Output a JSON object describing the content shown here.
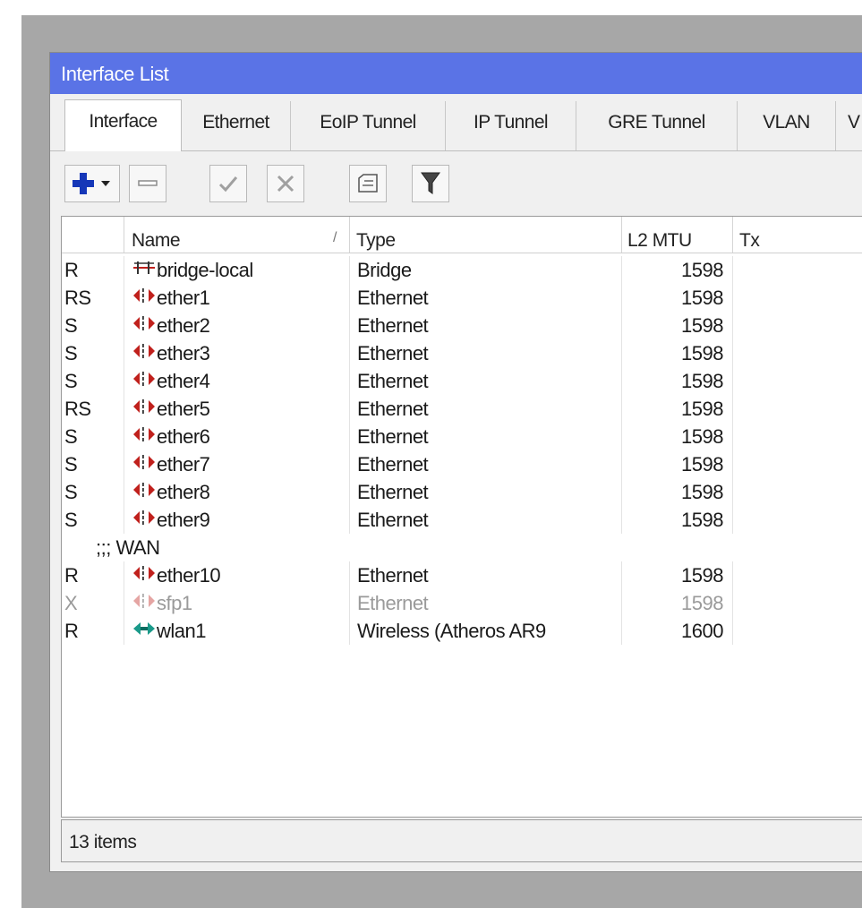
{
  "window": {
    "title": "Interface List"
  },
  "tabs": [
    {
      "label": "Interface",
      "active": true
    },
    {
      "label": "Ethernet",
      "active": false
    },
    {
      "label": "EoIP Tunnel",
      "active": false
    },
    {
      "label": "IP Tunnel",
      "active": false
    },
    {
      "label": "GRE Tunnel",
      "active": false
    },
    {
      "label": "VLAN",
      "active": false
    },
    {
      "label": "V",
      "active": false
    }
  ],
  "toolbar": {
    "buttons": [
      {
        "name": "add-dropdown-button",
        "icon": "plus-icon"
      },
      {
        "name": "remove-button",
        "icon": "minus-icon"
      },
      {
        "name": "enable-button",
        "icon": "check-icon"
      },
      {
        "name": "disable-button",
        "icon": "cross-icon"
      },
      {
        "name": "comment-button",
        "icon": "note-icon"
      },
      {
        "name": "filter-button",
        "icon": "funnel-icon"
      }
    ]
  },
  "table": {
    "columns": [
      "",
      "Name",
      "Type",
      "L2 MTU",
      "Tx"
    ],
    "sort_indicator": "/",
    "rows": [
      {
        "flags": "R",
        "name": "bridge-local",
        "icon": "bridge-icon",
        "type": "Bridge",
        "l2mtu": "1598"
      },
      {
        "flags": "RS",
        "name": "ether1",
        "icon": "ethernet-icon",
        "type": "Ethernet",
        "l2mtu": "1598"
      },
      {
        "flags": "S",
        "name": "ether2",
        "icon": "ethernet-icon",
        "type": "Ethernet",
        "l2mtu": "1598"
      },
      {
        "flags": "S",
        "name": "ether3",
        "icon": "ethernet-icon",
        "type": "Ethernet",
        "l2mtu": "1598"
      },
      {
        "flags": "S",
        "name": "ether4",
        "icon": "ethernet-icon",
        "type": "Ethernet",
        "l2mtu": "1598"
      },
      {
        "flags": "RS",
        "name": "ether5",
        "icon": "ethernet-icon",
        "type": "Ethernet",
        "l2mtu": "1598"
      },
      {
        "flags": "S",
        "name": "ether6",
        "icon": "ethernet-icon",
        "type": "Ethernet",
        "l2mtu": "1598"
      },
      {
        "flags": "S",
        "name": "ether7",
        "icon": "ethernet-icon",
        "type": "Ethernet",
        "l2mtu": "1598"
      },
      {
        "flags": "S",
        "name": "ether8",
        "icon": "ethernet-icon",
        "type": "Ethernet",
        "l2mtu": "1598"
      },
      {
        "flags": "S",
        "name": "ether9",
        "icon": "ethernet-icon",
        "type": "Ethernet",
        "l2mtu": "1598"
      },
      {
        "group": ";;; WAN"
      },
      {
        "flags": "R",
        "name": "ether10",
        "icon": "ethernet-icon",
        "type": "Ethernet",
        "l2mtu": "1598"
      },
      {
        "flags": "X",
        "name": "sfp1",
        "icon": "ethernet-icon",
        "type": "Ethernet",
        "l2mtu": "1598",
        "disabled": true
      },
      {
        "flags": "R",
        "name": "wlan1",
        "icon": "wireless-icon",
        "type": "Wireless (Atheros AR9",
        "l2mtu": "1600"
      }
    ]
  },
  "status": {
    "items_text": "13 items"
  },
  "colors": {
    "titlebar": "#5a73e6",
    "ethernet_icon": "#c0201c",
    "wireless_icon": "#1a9a8a",
    "disabled_text": "#9a9a9a"
  }
}
